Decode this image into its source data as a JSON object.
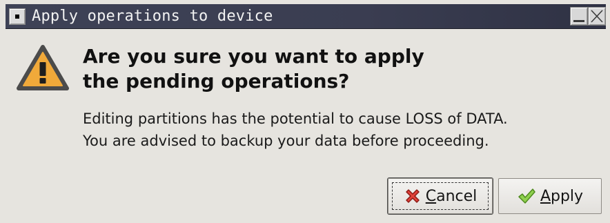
{
  "window": {
    "title": "Apply operations to device"
  },
  "dialog": {
    "heading_line1": "Are you sure you want to apply",
    "heading_line2": "the pending operations?",
    "message_line1": "Editing partitions has the potential to cause LOSS of DATA.",
    "message_line2": "You are advised to backup your data before proceeding."
  },
  "buttons": {
    "cancel": {
      "mnemonic": "C",
      "rest": "ancel",
      "icon": "cancel-x-icon"
    },
    "apply": {
      "mnemonic": "A",
      "rest": "pply",
      "icon": "checkmark-icon"
    }
  },
  "icons": {
    "warning": "warning-triangle-icon"
  },
  "colors": {
    "warning_fill": "#f0a93a",
    "warning_border": "#4a4a4a",
    "titlebar": "#3c3f52",
    "cancel_icon": "#d8302a",
    "apply_icon": "#7bc043"
  }
}
